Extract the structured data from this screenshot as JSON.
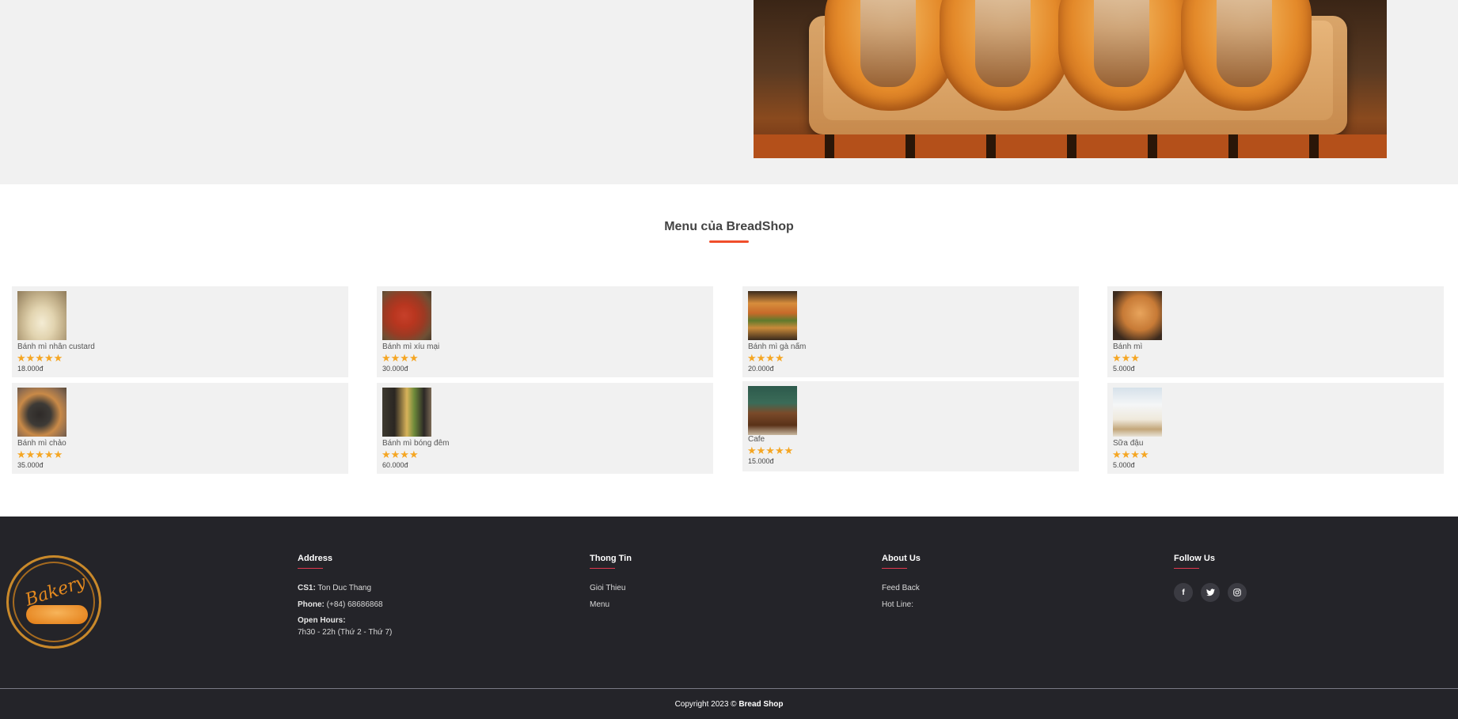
{
  "menu": {
    "title": "Menu của BreadShop",
    "products": [
      {
        "name": "Bánh mì nhân custard",
        "rating": 5,
        "price": "18.000đ",
        "thumb": "custard"
      },
      {
        "name": "Bánh mì xíu mại",
        "rating": 4,
        "price": "30.000đ",
        "thumb": "xiumai"
      },
      {
        "name": "Bánh mì gà nấm",
        "rating": 4,
        "price": "20.000đ",
        "thumb": "ganam"
      },
      {
        "name": "Bánh mì",
        "rating": 3,
        "price": "5.000đ",
        "thumb": "banhmi"
      },
      {
        "name": "Bánh mì chảo",
        "rating": 5,
        "price": "35.000đ",
        "thumb": "chao"
      },
      {
        "name": "Bánh mì bóng đêm",
        "rating": 4,
        "price": "60.000đ",
        "thumb": "bongdem"
      },
      {
        "name": "Cafe",
        "rating": 5,
        "price": "15.000đ",
        "thumb": "cafe"
      },
      {
        "name": "Sữa đậu",
        "rating": 4,
        "price": "5.000đ",
        "thumb": "suadau"
      }
    ]
  },
  "footer": {
    "logo_text": "Bakery",
    "address": {
      "title": "Address",
      "cs1_label": "CS1:",
      "cs1_value": "Ton Duc Thang",
      "phone_label": "Phone:",
      "phone_value": "(+84) 68686868",
      "hours_label": "Open Hours:",
      "hours_value": "7h30 - 22h (Thứ 2 - Thứ 7)"
    },
    "info": {
      "title": "Thong Tin",
      "links": [
        "Gioi Thieu",
        "Menu"
      ]
    },
    "about": {
      "title": "About Us",
      "links": [
        "Feed Back",
        "Hot Line:"
      ]
    },
    "follow": {
      "title": "Follow Us",
      "icons": [
        "facebook-icon",
        "twitter-icon",
        "instagram-icon"
      ]
    },
    "copyright_prefix": "Copyright 2023 © ",
    "copyright_brand": "Bread Shop"
  },
  "colors": {
    "accent": "#f04e2b",
    "star": "#f5a623",
    "footer_bg": "#242429",
    "footer_line": "#e2384f"
  }
}
